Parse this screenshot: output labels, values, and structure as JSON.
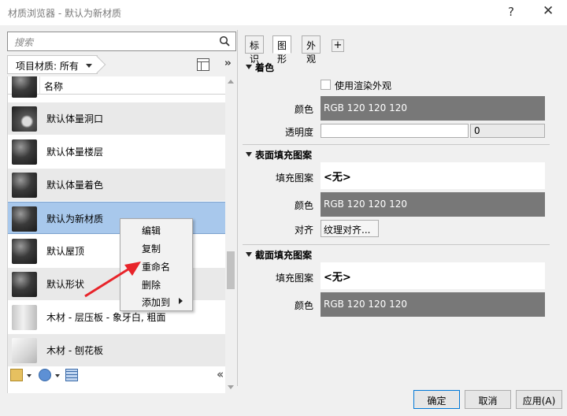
{
  "window": {
    "title": "材质浏览器 - 默认为新材质",
    "help": "?",
    "close": "✕"
  },
  "search": {
    "placeholder": "搜索"
  },
  "library": {
    "label": "项目材质: 所有"
  },
  "list": {
    "column": "名称",
    "items": [
      {
        "name": "默认体量洞口",
        "thumb": "hole"
      },
      {
        "name": "默认体量楼层",
        "thumb": "dark"
      },
      {
        "name": "默认体量着色",
        "thumb": "dark"
      },
      {
        "name": "默认为新材质",
        "thumb": "dark",
        "selected": true
      },
      {
        "name": "默认屋顶",
        "thumb": "dark"
      },
      {
        "name": "默认形状",
        "thumb": "dark"
      },
      {
        "name": "木材 - 层压板 - 象牙白, 粗面",
        "thumb": "wood"
      },
      {
        "name": "木材 - 刨花板",
        "thumb": "chip"
      }
    ]
  },
  "context_menu": {
    "items": [
      "编辑",
      "复制",
      "重命名",
      "删除",
      "添加到"
    ]
  },
  "tabs": [
    "标识",
    "图形",
    "外观",
    "+"
  ],
  "sections": {
    "shading": {
      "title": "着色",
      "use_render": "使用渲染外观",
      "color_label": "颜色",
      "color_value": "RGB 120 120 120",
      "transparency_label": "透明度",
      "transparency_value": "0"
    },
    "surface": {
      "title": "表面填充图案",
      "pattern_label": "填充图案",
      "pattern_value": "<无>",
      "color_label": "颜色",
      "color_value": "RGB 120 120 120",
      "align_label": "对齐",
      "align_button": "纹理对齐..."
    },
    "cut": {
      "title": "截面填充图案",
      "pattern_label": "填充图案",
      "pattern_value": "<无>",
      "color_label": "颜色",
      "color_value": "RGB 120 120 120"
    }
  },
  "buttons": {
    "ok": "确定",
    "cancel": "取消",
    "apply": "应用(A)"
  },
  "colors": {
    "swatch": "#787878",
    "selection": "#a8c8ec",
    "arrow": "#e8242a"
  }
}
